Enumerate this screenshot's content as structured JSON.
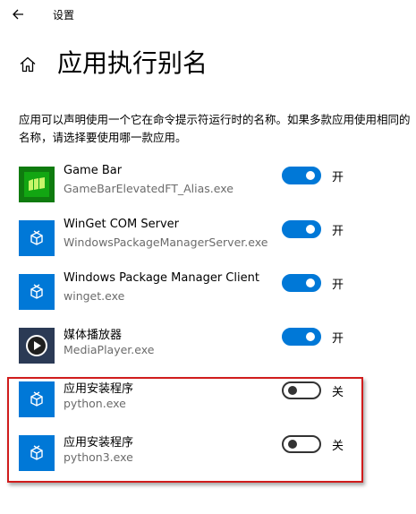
{
  "window": {
    "title": "设置",
    "back_icon": "arrow-left-icon"
  },
  "header": {
    "home_icon": "home-icon",
    "title": "应用执行别名"
  },
  "description": "应用可以声明使用一个它在命令提示符运行时的名称。如果多款应用使用相同的名称，请选择要使用哪一款应用。",
  "apps": [
    {
      "name": "Game Bar",
      "exe": "GameBarElevatedFT_Alias.exe",
      "state": "开",
      "on": true,
      "icon": "game-bar-icon"
    },
    {
      "name": "WinGet COM Server",
      "exe": "WindowsPackageManagerServer.exe",
      "state": "开",
      "on": true,
      "icon": "package-icon"
    },
    {
      "name": "Windows Package Manager Client",
      "exe": "winget.exe",
      "state": "开",
      "on": true,
      "icon": "package-icon"
    },
    {
      "name": "媒体播放器",
      "exe": "MediaPlayer.exe",
      "state": "开",
      "on": true,
      "icon": "media-player-icon"
    },
    {
      "name": "应用安装程序",
      "exe": "python.exe",
      "state": "关",
      "on": false,
      "icon": "package-icon"
    },
    {
      "name": "应用安装程序",
      "exe": "python3.exe",
      "state": "关",
      "on": false,
      "icon": "package-icon"
    }
  ],
  "colors": {
    "accent": "#0078d7",
    "highlight": "#d01c1c"
  }
}
